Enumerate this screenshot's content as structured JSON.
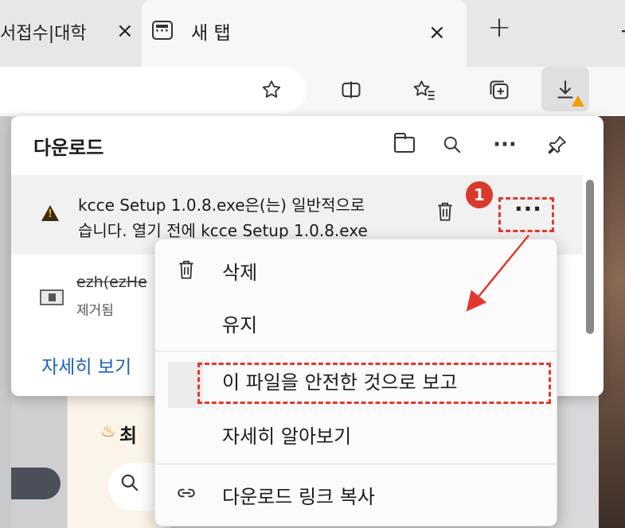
{
  "browser": {
    "tabs": [
      {
        "title": "서접수|대학",
        "close": "×"
      },
      {
        "title": "새 탭",
        "close": "×"
      }
    ],
    "new_tab": "+",
    "edge_glyph": "−"
  },
  "toolbar": {
    "icons": [
      "favorite-star-icon",
      "split-screen-icon",
      "favorites-icon",
      "collections-icon",
      "downloads-icon"
    ]
  },
  "downloads": {
    "title": "다운로드",
    "items": [
      {
        "line1": "kcce Setup 1.0.8.exe은(는) 일반적으로",
        "line2": "습니다. 열기 전에 kcce Setup 1.0.8.exe",
        "more": "···"
      },
      {
        "name": "ezh(ezHe",
        "status": "제거됨"
      }
    ],
    "see_more": "자세히 보기"
  },
  "context_menu": {
    "items": [
      {
        "label": "삭제",
        "icon": "trash-icon"
      },
      {
        "label": "유지",
        "icon": ""
      },
      {
        "label": "이 파일을 안전한 것으로 보고",
        "icon": ""
      },
      {
        "label": "자세히 알아보기",
        "icon": ""
      },
      {
        "label": "다운로드 링크 복사",
        "icon": "link-icon"
      }
    ]
  },
  "page_behind": {
    "card_text": "최"
  },
  "annotation": {
    "badge": "1",
    "accent_color": "#e0392b"
  }
}
